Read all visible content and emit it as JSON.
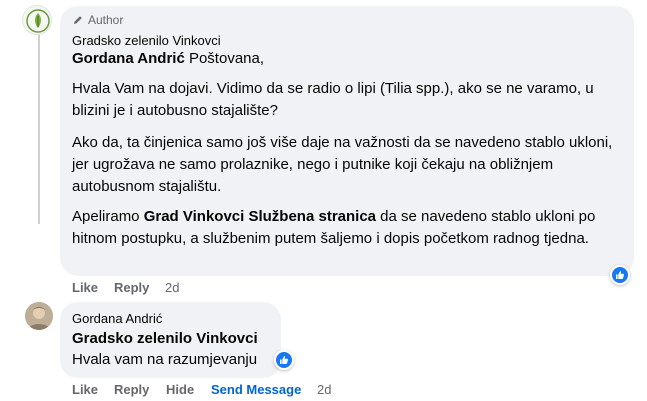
{
  "comment": {
    "author_badge": "Author",
    "name": "Gradsko zelenilo Vinkovci",
    "mention": "Gordana Andrić",
    "greeting": " Poštovana,",
    "paragraph_1": "Hvala Vam na dojavi. Vidimo da se radio o lipi (Tilia spp.), ako se ne varamo, u blizini je i autobusno stajalište?",
    "paragraph_2": "Ako da, ta činjenica samo još više daje na važnosti da se navedeno stablo ukloni, jer ugrožava ne samo prolaznike, nego i putnike koji čekaju na obližnjem autobusnom stajalištu.",
    "paragraph_3_pre": "Apeliramo ",
    "paragraph_3_mention": "Grad Vinkovci Službena stranica",
    "paragraph_3_post": " da se navedeno stablo ukloni po hitnom postupku, a službenim putem šaljemo i dopis početkom radnog tjedna.",
    "actions": {
      "like": "Like",
      "reply": "Reply",
      "time": "2d"
    }
  },
  "reply": {
    "name": "Gordana Andrić",
    "mention": "Gradsko zelenilo Vinkovci",
    "text": "Hvala vam na razumjevanju",
    "actions": {
      "like": "Like",
      "reply": "Reply",
      "hide": "Hide",
      "send_message": "Send Message",
      "time": "2d"
    }
  },
  "colors": {
    "bubble": "#f0f2f5",
    "link_blue": "#0064d1",
    "like_blue": "#1877f2",
    "muted": "#65676b"
  },
  "icons": {
    "author": "pen-icon",
    "reaction": "like-icon"
  }
}
